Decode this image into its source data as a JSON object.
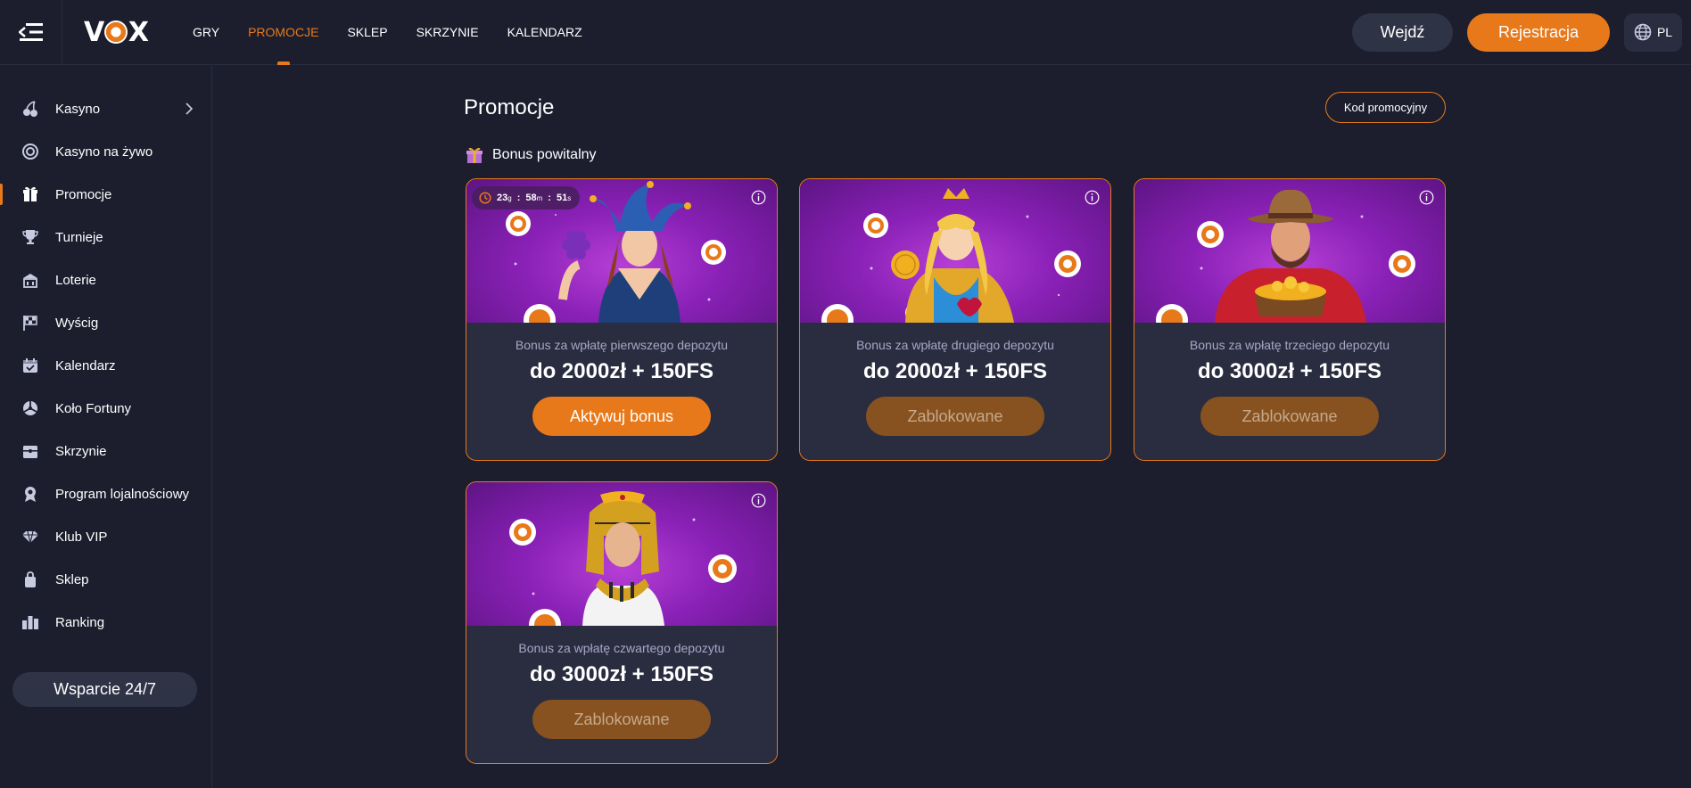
{
  "header": {
    "logo": "VOX",
    "nav": [
      {
        "label": "GRY",
        "active": false
      },
      {
        "label": "PROMOCJE",
        "active": true
      },
      {
        "label": "SKLEP",
        "active": false
      },
      {
        "label": "SKRZYNIE",
        "active": false
      },
      {
        "label": "KALENDARZ",
        "active": false
      }
    ],
    "login_label": "Wejdź",
    "register_label": "Rejestracja",
    "language": "PL"
  },
  "sidebar": {
    "items": [
      {
        "label": "Kasyno",
        "icon": "cherries-icon",
        "active": false,
        "has_submenu": true
      },
      {
        "label": "Kasyno na żywo",
        "icon": "live-chip-icon",
        "active": false
      },
      {
        "label": "Promocje",
        "icon": "gift-icon",
        "active": true
      },
      {
        "label": "Turnieje",
        "icon": "trophy-icon",
        "active": false
      },
      {
        "label": "Loterie",
        "icon": "lottery-icon",
        "active": false
      },
      {
        "label": "Wyścig",
        "icon": "race-flag-icon",
        "active": false
      },
      {
        "label": "Kalendarz",
        "icon": "calendar-icon",
        "active": false
      },
      {
        "label": "Koło Fortuny",
        "icon": "wheel-icon",
        "active": false
      },
      {
        "label": "Skrzynie",
        "icon": "chest-icon",
        "active": false
      },
      {
        "label": "Program lojalnościowy",
        "icon": "medal-icon",
        "active": false
      },
      {
        "label": "Klub VIP",
        "icon": "diamond-icon",
        "active": false
      },
      {
        "label": "Sklep",
        "icon": "shopping-bag-icon",
        "active": false
      },
      {
        "label": "Ranking",
        "icon": "ranking-icon",
        "active": false
      }
    ],
    "support_label": "Wsparcie 24/7"
  },
  "main": {
    "title": "Promocje",
    "promo_code_label": "Kod promocyjny",
    "section_title": "Bonus powitalny",
    "timer": {
      "days": "23",
      "days_unit": "g",
      "hours": "58",
      "hours_unit": "m",
      "seconds": "51",
      "seconds_unit": "s"
    },
    "cards": [
      {
        "subtitle": "Bonus za wpłatę pierwszego depozytu",
        "amount": "do 2000zł + 150FS",
        "button": "Aktywuj bonus",
        "state": "active",
        "character": "jester-woman"
      },
      {
        "subtitle": "Bonus za wpłatę drugiego depozytu",
        "amount": "do 2000zł + 150FS",
        "button": "Zablokowane",
        "state": "locked",
        "character": "queen"
      },
      {
        "subtitle": "Bonus za wpłatę trzeciego depozytu",
        "amount": "do 3000zł + 150FS",
        "button": "Zablokowane",
        "state": "locked",
        "character": "cowboy"
      },
      {
        "subtitle": "Bonus za wpłatę czwartego depozytu",
        "amount": "do 3000zł + 150FS",
        "button": "Zablokowane",
        "state": "locked",
        "character": "cleopatra"
      }
    ]
  },
  "colors": {
    "background": "#1c1e2e",
    "accent": "#e8791a",
    "card_bg": "#2a2d40",
    "locked_button": "#875220",
    "purple": "#8a21b7"
  }
}
